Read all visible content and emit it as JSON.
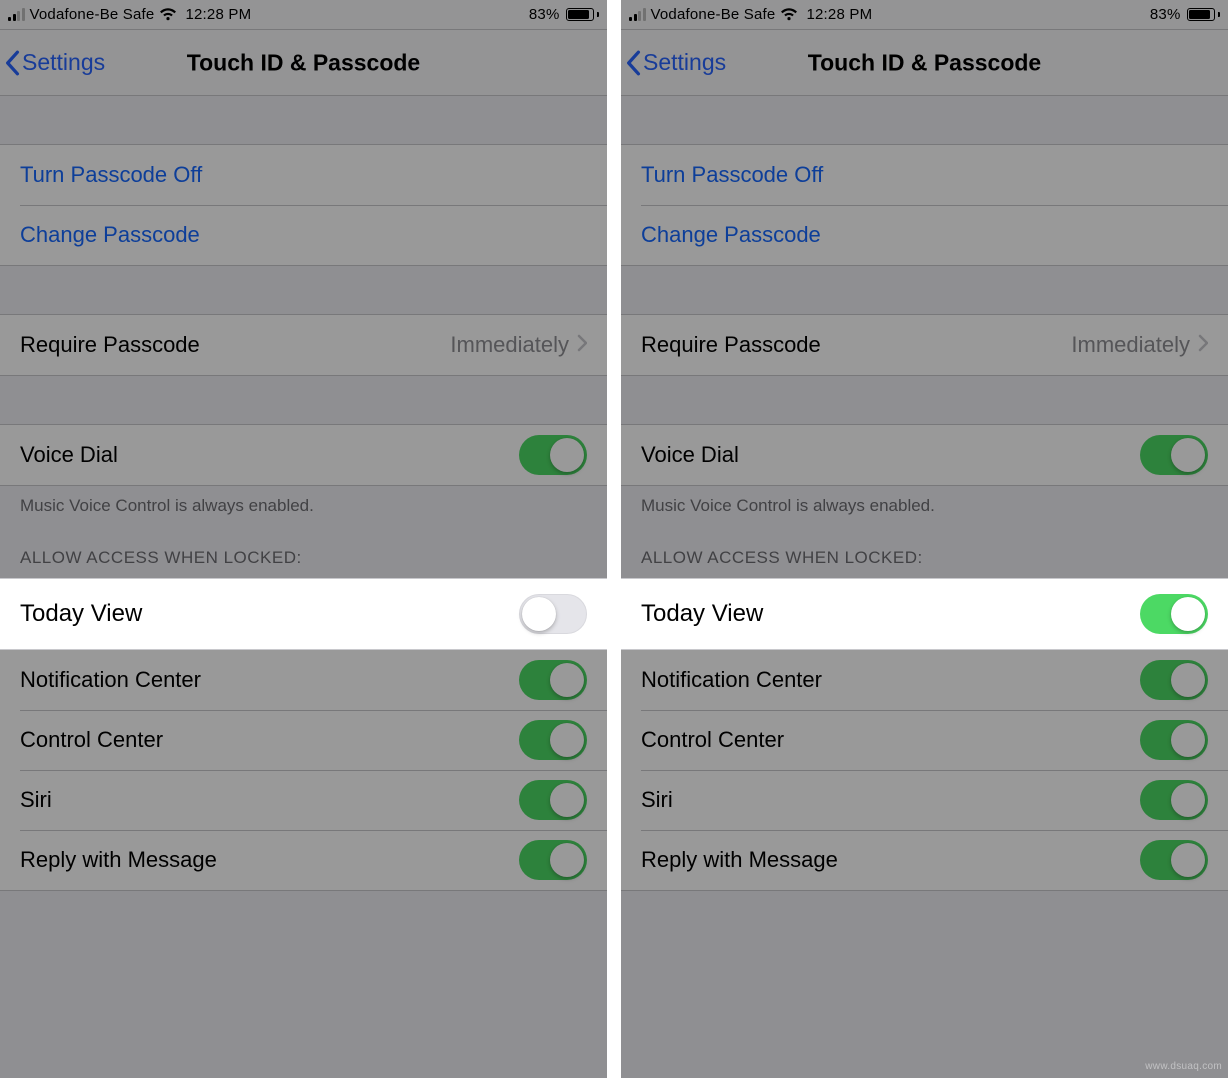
{
  "status": {
    "carrier": "Vodafone-Be Safe",
    "time": "12:28 PM",
    "battery_pct": "83%"
  },
  "nav": {
    "back_label": "Settings",
    "title": "Touch ID & Passcode"
  },
  "passcode": {
    "turn_off": "Turn Passcode Off",
    "change": "Change Passcode",
    "require_label": "Require Passcode",
    "require_value": "Immediately"
  },
  "voice": {
    "label": "Voice Dial",
    "footer": "Music Voice Control is always enabled."
  },
  "allow_header": "ALLOW ACCESS WHEN LOCKED:",
  "rows": {
    "today": "Today View",
    "notifications": "Notification Center",
    "control": "Control Center",
    "siri": "Siri",
    "reply": "Reply with Message"
  },
  "toggles": {
    "left": {
      "voice_dial": true,
      "today": false,
      "notifications": true,
      "control": true,
      "siri": true,
      "reply": true
    },
    "right": {
      "voice_dial": true,
      "today": true,
      "notifications": true,
      "control": true,
      "siri": true,
      "reply": true
    }
  },
  "colors": {
    "link": "#1668ff",
    "toggle_on": "#4cd964",
    "background": "#efeff4"
  },
  "watermark": "www.dsuaq.com"
}
